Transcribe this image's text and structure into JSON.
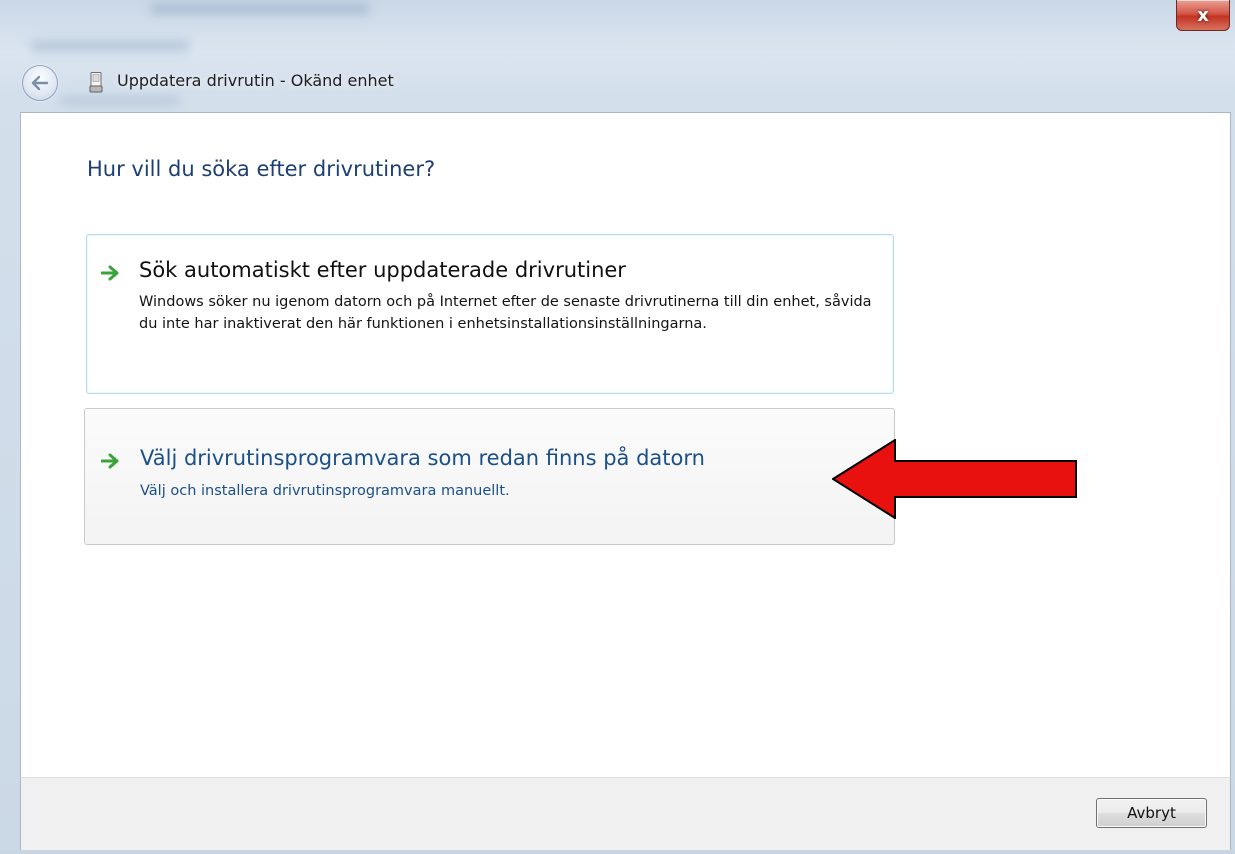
{
  "window": {
    "title": "Uppdatera drivrutin - Okänd enhet",
    "close_glyph": "x",
    "back_icon": "back-arrow-icon",
    "device_icon": "unknown-device-icon"
  },
  "main": {
    "heading": "Hur vill du söka efter drivrutiner?",
    "options": [
      {
        "title": "Sök automatiskt efter uppdaterade drivrutiner",
        "description": "Windows söker nu igenom datorn och på Internet efter de senaste drivrutinerna till din enhet, såvida du inte har inaktiverat den här funktionen i enhetsinstallationsinställningarna.",
        "icon": "green-arrow-icon"
      },
      {
        "title": "Välj drivrutinsprogramvara som redan finns på datorn",
        "description": "Välj och installera drivrutinsprogramvara manuellt.",
        "icon": "green-arrow-icon"
      }
    ]
  },
  "annotation": {
    "icon": "red-pointer-arrow",
    "color": "#e8110f"
  },
  "footer": {
    "cancel_label": "Avbryt"
  },
  "colors": {
    "heading": "#1e3f73",
    "link_text": "#1a4f8a",
    "accent_green": "#3aa33a"
  }
}
